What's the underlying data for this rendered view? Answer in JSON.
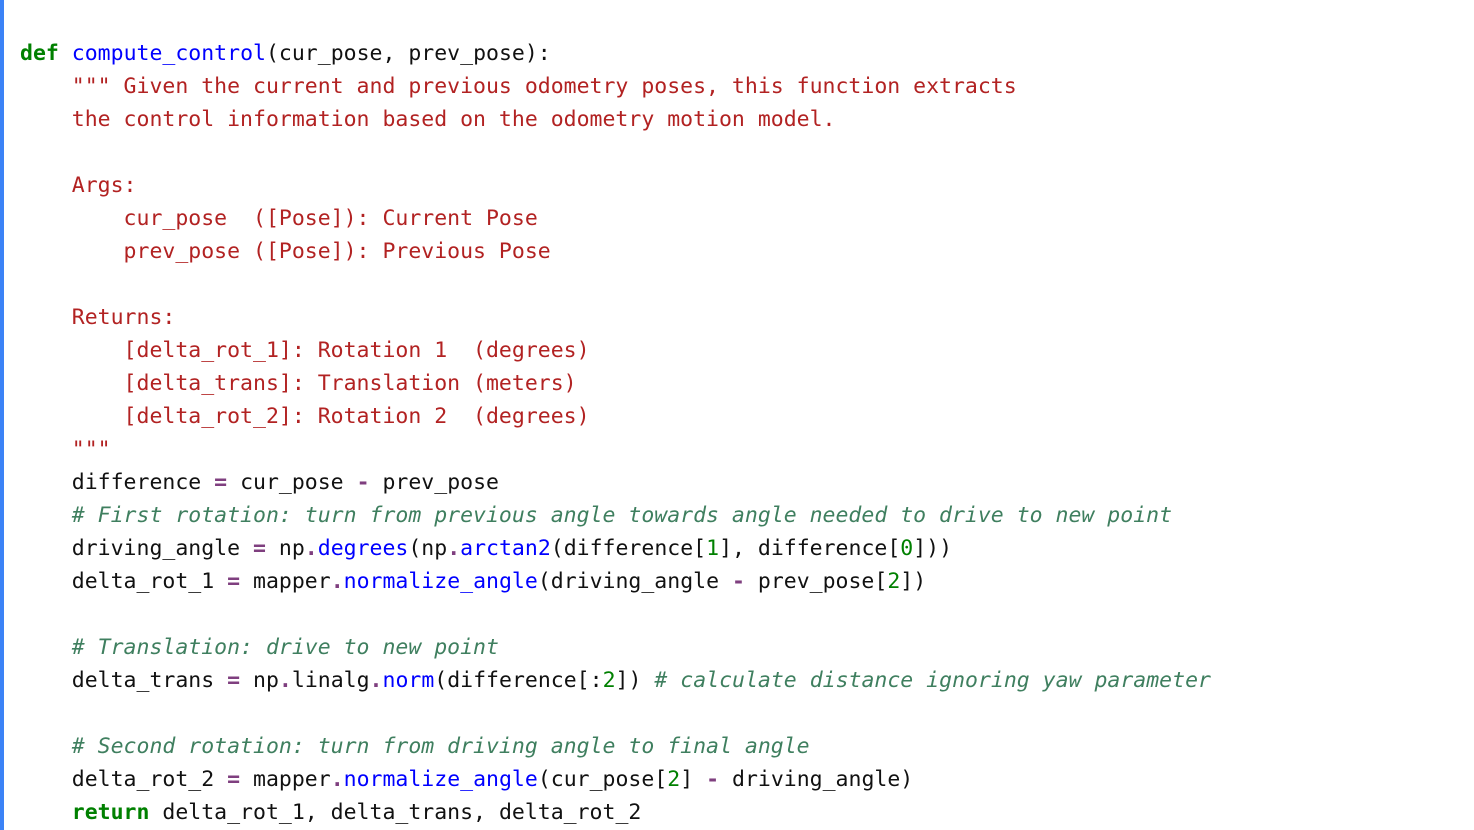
{
  "code": {
    "l1": {
      "def": "def",
      "name": "compute_control",
      "params": "(cur_pose, prev_pose):"
    },
    "l2": "\"\"\" Given the current and previous odometry poses, this function extracts",
    "l3": "the control information based on the odometry motion model.",
    "l4": "",
    "l5": "Args:",
    "l6": "    cur_pose  ([Pose]): Current Pose",
    "l7": "    prev_pose ([Pose]): Previous Pose",
    "l8": "",
    "l9": "Returns:",
    "l10": "    [delta_rot_1]: Rotation 1  (degrees)",
    "l11": "    [delta_trans]: Translation (meters)",
    "l12": "    [delta_rot_2]: Rotation 2  (degrees)",
    "l13": "\"\"\"",
    "l14": {
      "a": "difference ",
      "op": "=",
      "b": " cur_pose ",
      "op2": "-",
      "c": " prev_pose"
    },
    "l15": "# First rotation: turn from previous angle towards angle needed to drive to new point",
    "l16": {
      "a": "driving_angle ",
      "op": "=",
      "b": " np",
      "dot": ".",
      "m1": "degrees",
      "p1": "(np",
      "dot2": ".",
      "m2": "arctan2",
      "p2": "(difference[",
      "n1": "1",
      "p3": "], difference[",
      "n0": "0",
      "p4": "]))"
    },
    "l17": {
      "a": "delta_rot_1 ",
      "op": "=",
      "b": " mapper",
      "dot": ".",
      "m1": "normalize_angle",
      "p1": "(driving_angle ",
      "op2": "-",
      "p2": " prev_pose[",
      "n2": "2",
      "p3": "])"
    },
    "l18": "",
    "l19": "# Translation: drive to new point",
    "l20": {
      "a": "delta_trans ",
      "op": "=",
      "b": " np",
      "dot": ".",
      "sub": "linalg",
      "dot2": ".",
      "m1": "norm",
      "p1": "(difference[:",
      "n2": "2",
      "p2": "]) ",
      "cm": "# calculate distance ignoring yaw parameter"
    },
    "l21": "",
    "l22": "# Second rotation: turn from driving angle to final angle",
    "l23": {
      "a": "delta_rot_2 ",
      "op": "=",
      "b": " mapper",
      "dot": ".",
      "m1": "normalize_angle",
      "p1": "(cur_pose[",
      "n2": "2",
      "p2": "] ",
      "op2": "-",
      "p3": " driving_angle)"
    },
    "l24": {
      "ret": "return",
      "rest": " delta_rot_1, delta_trans, delta_rot_2"
    }
  },
  "colors": {
    "border": "#3b82f6",
    "keyword": "#008000",
    "funcname": "#0000ff",
    "docstring": "#b22222",
    "comment": "#3f7f5f",
    "operator": "#7f3f7f",
    "number": "#008000"
  }
}
